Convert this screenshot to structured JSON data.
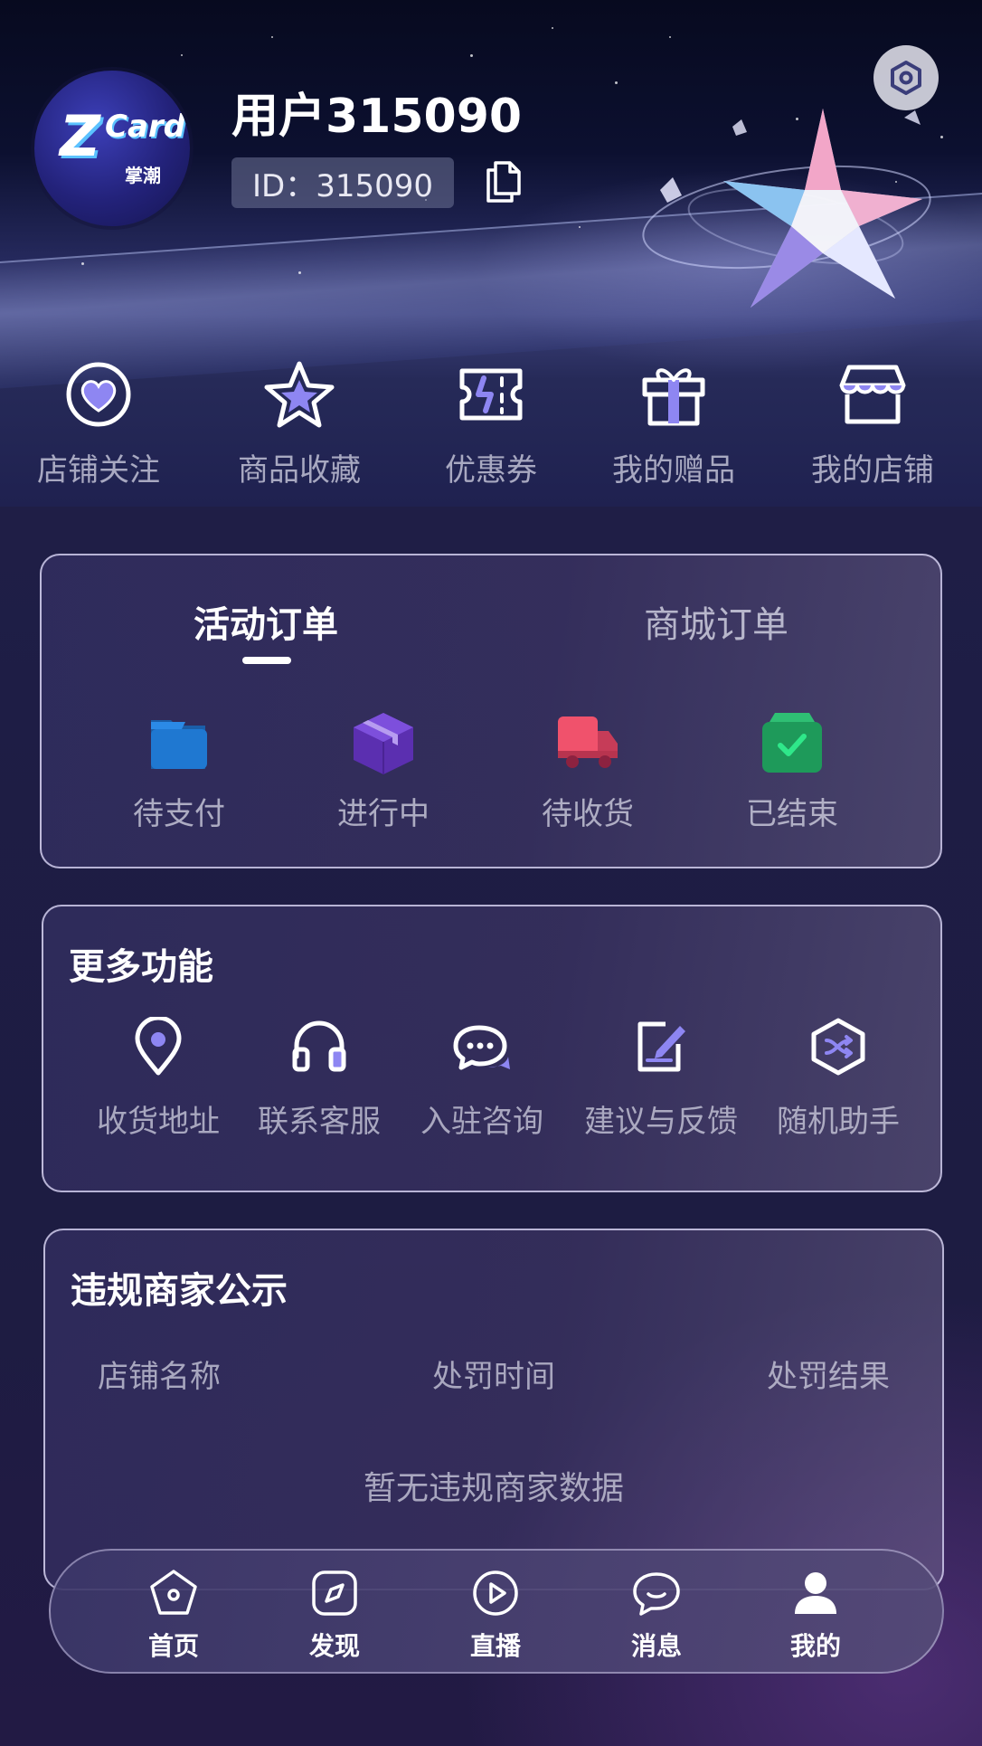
{
  "profile": {
    "username": "用户315090",
    "id_label": "ID：315090",
    "avatar_brand": "ZCard",
    "avatar_brand_z": "Z",
    "avatar_brand_card": "Card",
    "avatar_sub": "掌潮"
  },
  "quick_links": [
    {
      "label": "店铺关注",
      "icon": "heart-circle-icon"
    },
    {
      "label": "商品收藏",
      "icon": "star-icon"
    },
    {
      "label": "优惠券",
      "icon": "ticket-icon"
    },
    {
      "label": "我的赠品",
      "icon": "gift-icon"
    },
    {
      "label": "我的店铺",
      "icon": "store-icon"
    }
  ],
  "orders": {
    "tabs": [
      "活动订单",
      "商城订单"
    ],
    "active_tab": "活动订单",
    "statuses": [
      {
        "label": "待支付",
        "icon": "folder-icon",
        "color": "#1f6fc4"
      },
      {
        "label": "进行中",
        "icon": "box-icon",
        "color": "#6a3cc8"
      },
      {
        "label": "待收货",
        "icon": "truck-icon",
        "color": "#ee4d66"
      },
      {
        "label": "已结束",
        "icon": "check-bag-icon",
        "color": "#1e9a5a"
      }
    ]
  },
  "more_functions": {
    "title": "更多功能",
    "items": [
      {
        "label": "收货地址",
        "icon": "location-pin-icon"
      },
      {
        "label": "联系客服",
        "icon": "headset-icon"
      },
      {
        "label": "入驻咨询",
        "icon": "chat-bubbles-icon"
      },
      {
        "label": "建议与反馈",
        "icon": "edit-note-icon"
      },
      {
        "label": "随机助手",
        "icon": "shuffle-hexagon-icon"
      }
    ]
  },
  "violations": {
    "title": "违规商家公示",
    "columns": [
      "店铺名称",
      "处罚时间",
      "处罚结果"
    ],
    "empty_text": "暂无违规商家数据"
  },
  "bottom_nav": [
    {
      "label": "首页",
      "icon": "home-pentagon-icon"
    },
    {
      "label": "发现",
      "icon": "compass-icon"
    },
    {
      "label": "直播",
      "icon": "play-circle-icon"
    },
    {
      "label": "消息",
      "icon": "message-icon"
    },
    {
      "label": "我的",
      "icon": "user-icon",
      "active": true
    }
  ],
  "colors": {
    "accent": "#8e86f2",
    "background": "#1e1d45"
  }
}
